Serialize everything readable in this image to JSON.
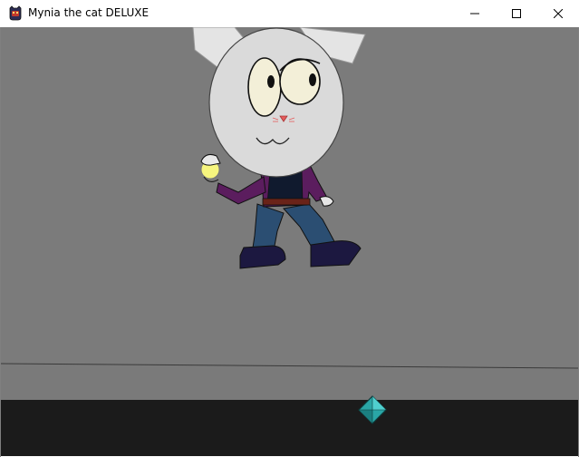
{
  "window": {
    "title": "Mynia the cat DELUXE",
    "icon": "game-app-icon",
    "controls": [
      "minimize-icon",
      "maximize-icon",
      "close-icon"
    ]
  },
  "scene": {
    "background_color": "#7b7b7b",
    "floor_color": "#7a7a7a",
    "ground_strip_color": "#1b1b1b",
    "gem_color": "#2aa6a6",
    "player": "cat-character",
    "pickup": "gem-pickup"
  }
}
